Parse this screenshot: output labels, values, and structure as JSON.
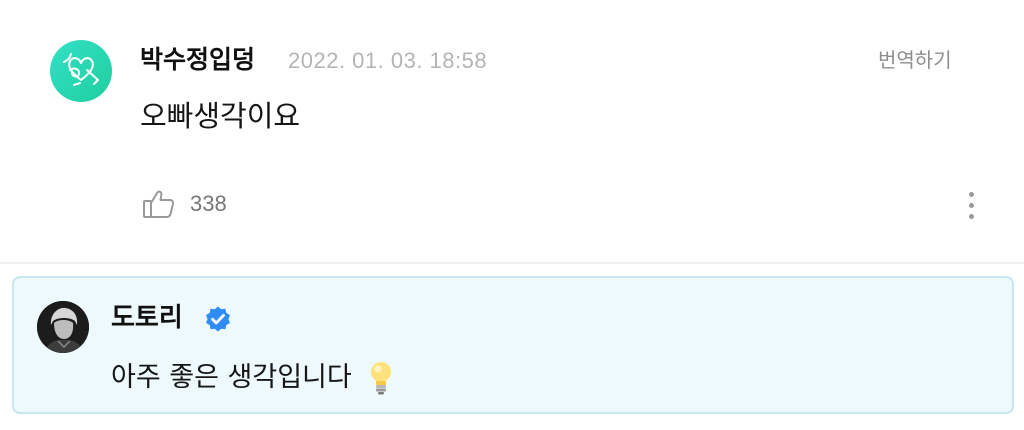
{
  "comment": {
    "author": "박수정입덩",
    "timestamp": "2022. 01. 03. 18:58",
    "translate_label": "번역하기",
    "text": "오빠생각이요",
    "like_count": "338",
    "avatar_icon": "heart-doodle-icon",
    "like_icon": "thumbs-up-icon",
    "more_icon": "more-vertical-icon",
    "avatar_color": "#2ad9b4"
  },
  "reply": {
    "author": "도토리",
    "verified_icon": "verified-badge-icon",
    "verified_color": "#2f8cf5",
    "text": "아주 좋은 생각입니다",
    "emoji_icon": "light-bulb-icon",
    "background_color": "#eef9fd",
    "border_color": "#c8e6f0"
  }
}
